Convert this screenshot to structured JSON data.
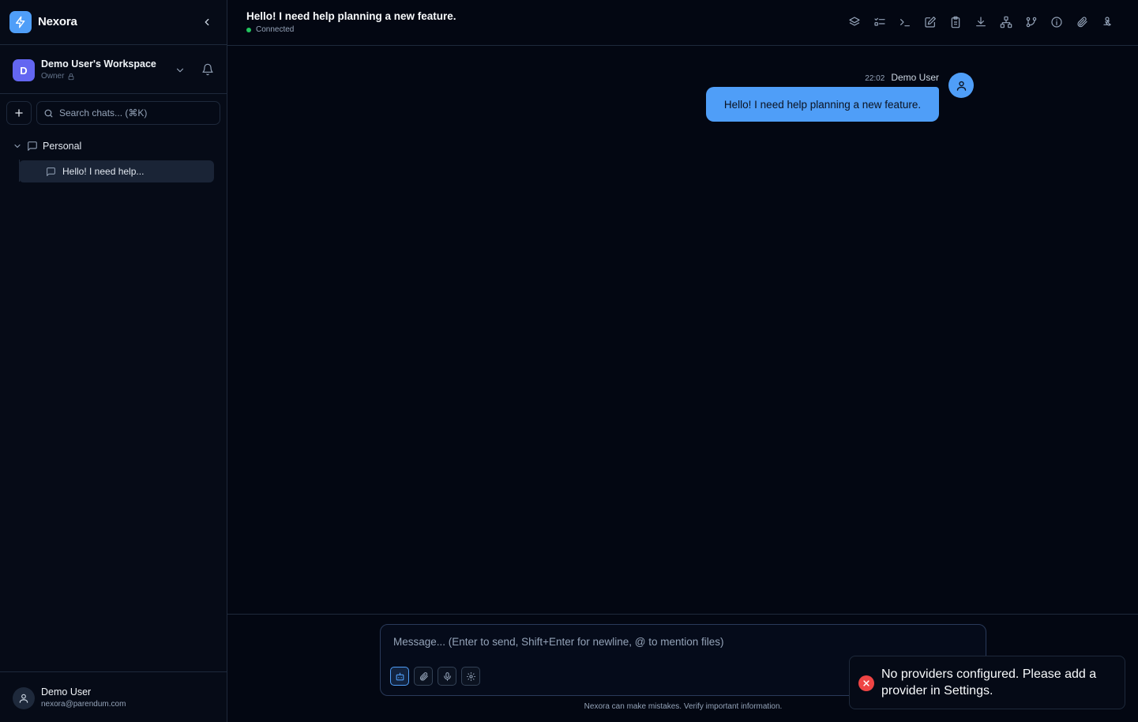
{
  "app": {
    "name": "Nexora"
  },
  "workspace": {
    "initial": "D",
    "name": "Demo User's Workspace",
    "role": "Owner"
  },
  "search": {
    "placeholder": "Search chats... (⌘K)"
  },
  "folders": [
    {
      "name": "Personal",
      "chats": [
        {
          "title": "Hello! I need help..."
        }
      ]
    }
  ],
  "user": {
    "name": "Demo User",
    "email": "nexora@parendum.com"
  },
  "header": {
    "title": "Hello! I need help planning a new feature.",
    "status": "Connected",
    "toolbar_icons": [
      "layers-icon",
      "list-checks-icon",
      "terminal-icon",
      "edit-icon",
      "clipboard-icon",
      "download-icon",
      "sitemap-icon",
      "git-branch-icon",
      "info-icon",
      "paperclip-icon",
      "webhook-icon"
    ]
  },
  "messages": [
    {
      "time": "22:02",
      "author": "Demo User",
      "text": "Hello! I need help planning a new feature."
    }
  ],
  "composer": {
    "placeholder": "Message... (Enter to send, Shift+Enter for newline, @ to mention files)",
    "tools": [
      "bot-icon",
      "paperclip-icon",
      "microphone-icon",
      "settings-icon"
    ]
  },
  "disclaimer": "Nexora can make mistakes. Verify important information.",
  "toast": {
    "message": "No providers configured. Please add a provider in Settings."
  },
  "colors": {
    "accent": "#4f9ef8",
    "background": "#030712",
    "sidebar": "#060b17",
    "success": "#22c55e",
    "error": "#ef4444",
    "workspace_avatar": "#6366f1"
  }
}
